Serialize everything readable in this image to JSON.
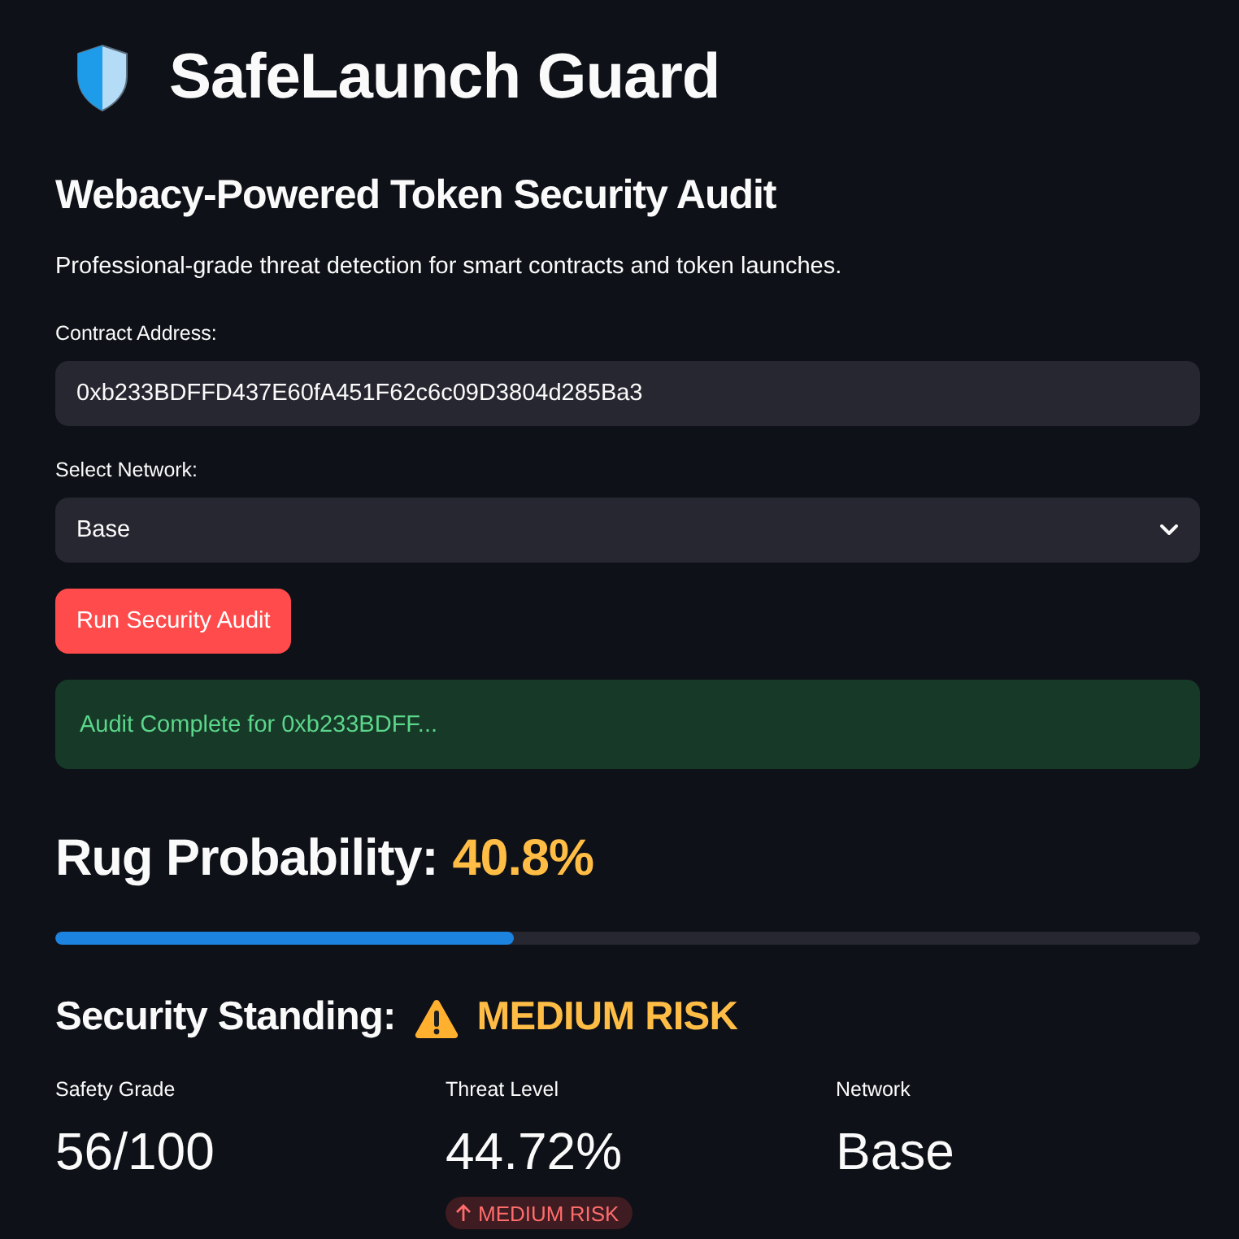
{
  "header": {
    "title": "SafeLaunch Guard"
  },
  "subtitle": "Webacy-Powered Token Security Audit",
  "description": "Professional-grade threat detection for smart contracts and token launches.",
  "form": {
    "address": {
      "label": "Contract Address:",
      "value": "0xb233BDFFD437E60fA451F62c6c09D3804d285Ba3"
    },
    "network": {
      "label": "Select Network:",
      "value": "Base"
    },
    "submit": "Run Security Audit"
  },
  "alert": {
    "kind": "success",
    "text": "Audit Complete for 0xb233BDFF..."
  },
  "rug_probability": {
    "label": "Rug Probability:",
    "value": "40.8%",
    "level": 0.4
  },
  "standing": {
    "label": "Security Standing:",
    "kind": "warning",
    "value": "MEDIUM RISK"
  },
  "metrics": [
    {
      "label": "Safety Grade",
      "value": "56/100"
    },
    {
      "label": "Threat Level",
      "value": "44.72%",
      "delta": {
        "text": "MEDIUM RISK",
        "up": true
      }
    },
    {
      "label": "Network",
      "value": "Base"
    }
  ]
}
